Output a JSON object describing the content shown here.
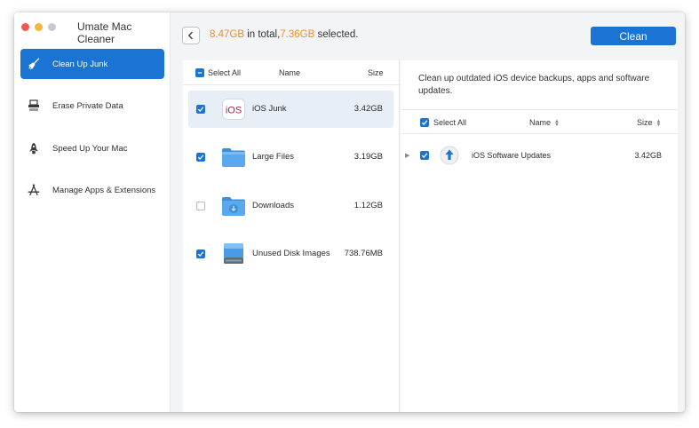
{
  "app": {
    "title": "Umate Mac Cleaner"
  },
  "sidebar": {
    "items": [
      {
        "label": "Clean Up Junk",
        "icon": "broom-icon",
        "active": true
      },
      {
        "label": "Erase Private Data",
        "icon": "shredder-icon",
        "active": false
      },
      {
        "label": "Speed Up Your Mac",
        "icon": "rocket-icon",
        "active": false
      },
      {
        "label": "Manage Apps & Extensions",
        "icon": "app-store-icon",
        "active": false
      }
    ]
  },
  "header": {
    "total_size": "8.47GB",
    "total_text": " in total,",
    "selected_size": "7.36GB",
    "selected_text": " selected.",
    "clean_label": "Clean",
    "accent_color": "#1b74d4",
    "highlight_color": "#e8902a"
  },
  "left_list": {
    "select_all_label": "Select All",
    "name_header": "Name",
    "size_header": "Size",
    "rows": [
      {
        "name": "iOS Junk",
        "size": "3.42GB",
        "checked": true,
        "icon": "ios-icon",
        "icon_text": "iOS"
      },
      {
        "name": "Large Files",
        "size": "3.19GB",
        "checked": true,
        "icon": "folder-icon"
      },
      {
        "name": "Downloads",
        "size": "1.12GB",
        "checked": false,
        "icon": "downloads-folder-icon"
      },
      {
        "name": "Unused Disk Images",
        "size": "738.76MB",
        "checked": true,
        "icon": "disk-image-icon"
      }
    ]
  },
  "right_panel": {
    "description": "Clean up outdated iOS device backups, apps and software updates.",
    "select_all_label": "Select All",
    "name_header": "Name",
    "size_header": "Size",
    "rows": [
      {
        "name": "iOS Software Updates",
        "size": "3.42GB",
        "checked": true,
        "icon": "upload-arrow-icon"
      }
    ]
  }
}
